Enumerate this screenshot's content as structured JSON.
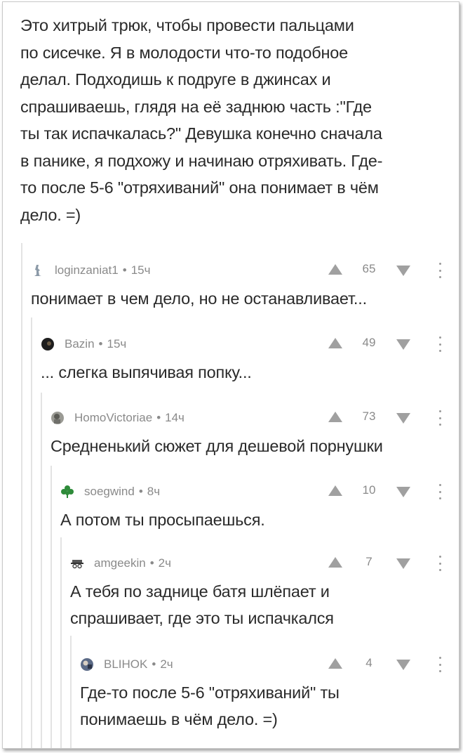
{
  "post": {
    "text_lines": [
      "Это хитрый трюк, чтобы провести пальцами",
      "по сисечке. Я в молодости что-то подобное",
      "делал. Подходишь к подруге в джинсах и",
      "спрашиваешь, глядя на её заднюю часть :\"Где",
      "ты так испачкалась?\" Девушка конечно сначала",
      "в панике, я подхожу и начинаю отряхивать. Где-",
      "то после 5-6 \"отряхиваний\" она понимает в чём",
      "дело. =)"
    ]
  },
  "comments": [
    {
      "username": "loginzaniat1",
      "sep": "•",
      "time": "15ч",
      "score": "65",
      "avatar_icon": "ghost-figure-icon",
      "lines": [
        "понимает в чем дело, но не останавливает..."
      ]
    },
    {
      "username": "Bazin",
      "sep": "•",
      "time": "15ч",
      "score": "49",
      "avatar_icon": "dark-round-avatar-icon",
      "lines": [
        "... слегка выпячивая попку..."
      ]
    },
    {
      "username": "HomoVictoriae",
      "sep": "•",
      "time": "14ч",
      "score": "73",
      "avatar_icon": "gray-photo-avatar-icon",
      "lines": [
        "Средненький сюжет для дешевой порнушки"
      ]
    },
    {
      "username": "soegwind",
      "sep": "•",
      "time": "8ч",
      "score": "10",
      "avatar_icon": "clover-icon",
      "lines": [
        "А потом ты просыпаешься."
      ]
    },
    {
      "username": "amgeekin",
      "sep": "•",
      "time": "2ч",
      "score": "7",
      "avatar_icon": "hat-glasses-icon",
      "lines": [
        "А тебя по заднице батя шлёпает и",
        "спрашивает, где это ты испачкался"
      ]
    },
    {
      "username": "BLIHOK",
      "sep": "•",
      "time": "2ч",
      "score": "4",
      "avatar_icon": "photo-avatar-icon",
      "lines": [
        "Где-то после 5-6 \"отряхиваний\" ты",
        "понимаешь в чём дело. =)"
      ]
    }
  ],
  "colors": {
    "text": "#2a2a2a",
    "meta": "#8a8a8a",
    "thread_line": "#e3e3e3",
    "vote_arrow": "#a0a0a0",
    "clover": "#2e8b3a"
  }
}
